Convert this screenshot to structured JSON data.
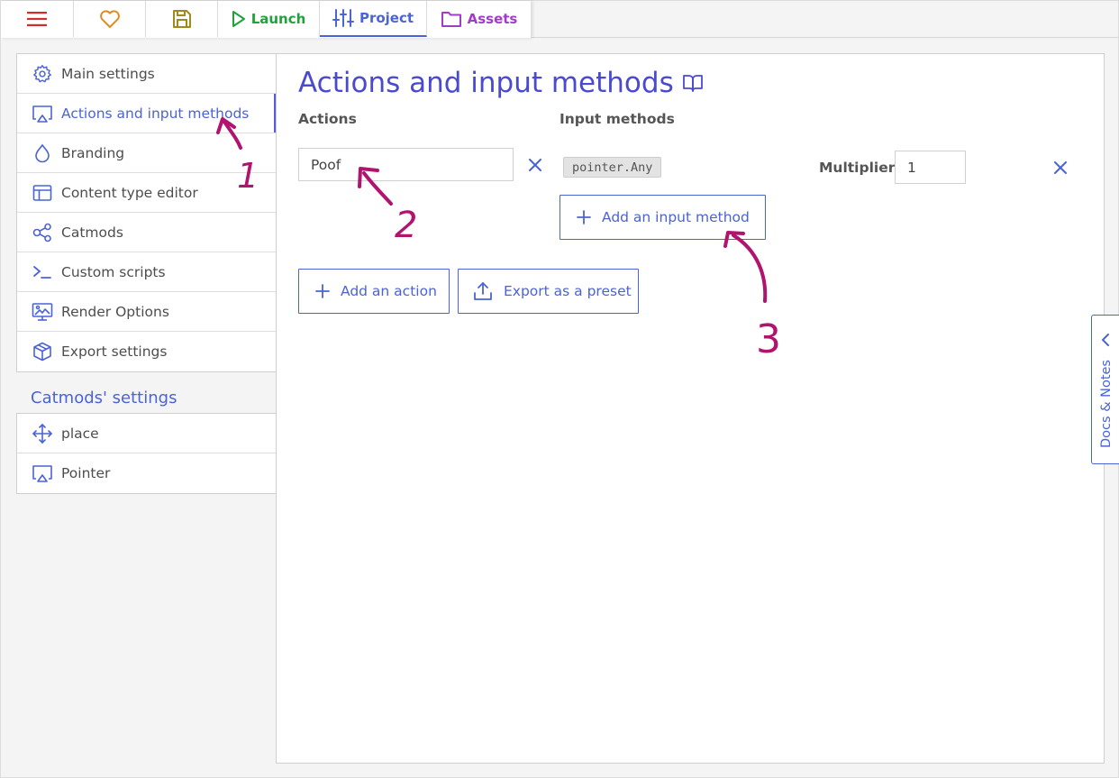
{
  "topbar": {
    "tabs": [
      {
        "icon": "hamburger-menu-icon",
        "label": ""
      },
      {
        "icon": "heart-icon",
        "label": ""
      },
      {
        "icon": "floppy-save-icon",
        "label": ""
      },
      {
        "icon": "play-icon",
        "label": "Launch"
      },
      {
        "icon": "sliders-icon",
        "label": "Project"
      },
      {
        "icon": "folder-icon",
        "label": "Assets"
      }
    ],
    "colors": {
      "menu": "#d62b2b",
      "fav": "#e08a1e",
      "save": "#a08a1a",
      "launch": "#1ea33a",
      "project": "#4a63d6",
      "assets": "#a13cc9"
    }
  },
  "sidebar": {
    "items": [
      {
        "icon": "gear-icon",
        "label": "Main settings"
      },
      {
        "icon": "airplay-icon",
        "label": "Actions and input methods",
        "active": true
      },
      {
        "icon": "droplet-icon",
        "label": "Branding"
      },
      {
        "icon": "layout-icon",
        "label": "Content type editor"
      },
      {
        "icon": "share-nodes-icon",
        "label": "Catmods"
      },
      {
        "icon": "terminal-icon",
        "label": "Custom scripts"
      },
      {
        "icon": "monitor-image-icon",
        "label": "Render Options"
      },
      {
        "icon": "package-icon",
        "label": "Export settings"
      }
    ],
    "catmods_title": "Catmods' settings",
    "catmods_items": [
      {
        "icon": "move-arrows-icon",
        "label": "place"
      },
      {
        "icon": "airplay-icon",
        "label": "Pointer"
      }
    ]
  },
  "main": {
    "title": "Actions and input methods",
    "title_icon": "book-open-icon",
    "actions_header": "Actions",
    "input_methods_header": "Input methods",
    "action_name": "Poof",
    "input_method_code": "pointer.Any",
    "multiplier_label": "Multiplier:",
    "multiplier_value": "1",
    "add_input_method_label": "Add an input method",
    "add_action_label": "Add an action",
    "export_preset_label": "Export as a preset"
  },
  "docs": {
    "label": "Docs & Notes"
  },
  "annotations": [
    "1",
    "2",
    "3"
  ],
  "annotation_color": "#b0146e"
}
